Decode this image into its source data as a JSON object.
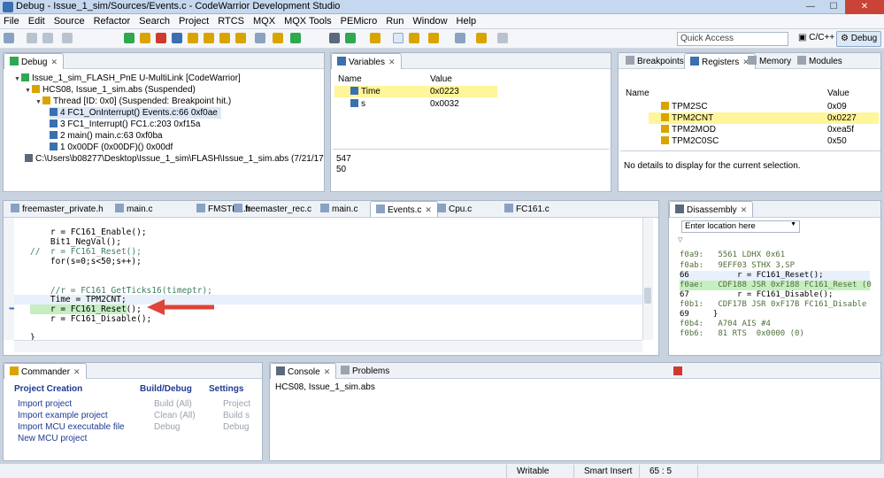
{
  "window": {
    "title": "Debug - Issue_1_sim/Sources/Events.c - CodeWarrior Development Studio",
    "controls": [
      "—",
      "☐",
      "✕"
    ]
  },
  "menu": [
    "File",
    "Edit",
    "Source",
    "Refactor",
    "Search",
    "Project",
    "RTCS",
    "MQX",
    "MQX Tools",
    "PEMicro",
    "Run",
    "Window",
    "Help"
  ],
  "toolbar": {
    "quick_access_placeholder": "Quick Access",
    "perspectives": [
      "C/C++",
      "Debug"
    ]
  },
  "debug_view": {
    "tab": "Debug",
    "tree": [
      "Issue_1_sim_FLASH_PnE U-MultiLink [CodeWarrior]",
      "HCS08, Issue_1_sim.abs (Suspended)",
      "Thread [ID: 0x0] (Suspended: Breakpoint hit.)",
      "4 FC1_OnInterrupt() Events.c:66 0xf0ae",
      "3 FC1_Interrupt() FC1.c:203 0xf15a",
      "2 main() main.c:63 0xf0ba",
      "1 0x00DF (0x00DF)() 0x00df",
      "C:\\Users\\b08277\\Desktop\\Issue_1_sim\\FLASH\\Issue_1_sim.abs (7/21/17 4:31 PM)"
    ]
  },
  "variables_view": {
    "tab": "Variables",
    "columns": [
      "Name",
      "Value"
    ],
    "rows": [
      {
        "name": "Time",
        "value": "0x0223"
      },
      {
        "name": "s",
        "value": "0x0032"
      }
    ],
    "detail": [
      "547",
      "50"
    ]
  },
  "registers_view": {
    "tabs": [
      "Breakpoints",
      "Registers",
      "Memory",
      "Modules"
    ],
    "columns": [
      "Name",
      "Value"
    ],
    "rows": [
      {
        "name": "TPM2SC",
        "value": "0x09"
      },
      {
        "name": "TPM2CNT",
        "value": "0x0227"
      },
      {
        "name": "TPM2MOD",
        "value": "0xea5f"
      },
      {
        "name": "TPM2C0SC",
        "value": "0x50"
      }
    ],
    "detail": "No details to display for the current selection."
  },
  "editor": {
    "tabs": [
      "freemaster_private.h",
      "main.c",
      "FMSTR1.h",
      "freemaster_rec.c",
      "main.c",
      "Events.c",
      "Cpu.c",
      "FC161.c"
    ],
    "active_tab": "Events.c",
    "lines": [
      "    r = FC161_Enable();",
      "    Bit1_NegVal();",
      "//  r = FC161_Reset();",
      "    for(s=0;s<50;s++);",
      "",
      "",
      "    //r = FC161_GetTicks16(timeptr);",
      "    Time = TPM2CNT;",
      "    r = FC161_Reset();",
      "    r = FC161_Disable();",
      "",
      "}"
    ]
  },
  "disassembly": {
    "tab": "Disassembly",
    "location_placeholder": "Enter location here",
    "lines": [
      "f0a9:   5561 LDHX 0x61",
      "f0ab:   9EFF03 STHX 3,SP",
      "66          r = FC161_Reset();",
      "f0ae:   CDF188 JSR 0xF188 FC161_Reset (0",
      "67          r = FC161_Disable();",
      "f0b1:   CDF17B JSR 0xF17B FC161_Disable",
      "69     }",
      "f0b4:   A704 AIS #4",
      "f0b6:   81 RTS  0x0000 (0)"
    ]
  },
  "commander": {
    "tab": "Commander",
    "sections": [
      {
        "title": "Project Creation",
        "items": [
          "Import project",
          "Import example project",
          "Import MCU executable file",
          "New MCU project"
        ]
      },
      {
        "title": "Build/Debug",
        "items": [
          "Build  (All)",
          "Clean  (All)",
          "Debug"
        ]
      },
      {
        "title": "Settings",
        "items": [
          "Project",
          "Build s",
          "Debug"
        ]
      }
    ]
  },
  "console": {
    "tabs": [
      "Console",
      "Problems"
    ],
    "text": "HCS08, Issue_1_sim.abs"
  },
  "statusbar": {
    "mode": "Writable",
    "insert": "Smart Insert",
    "position": "65 : 5"
  },
  "colors": {
    "highlight": "#fff59a",
    "current_line": "#c6eec0",
    "arrow": "#e0433a"
  }
}
